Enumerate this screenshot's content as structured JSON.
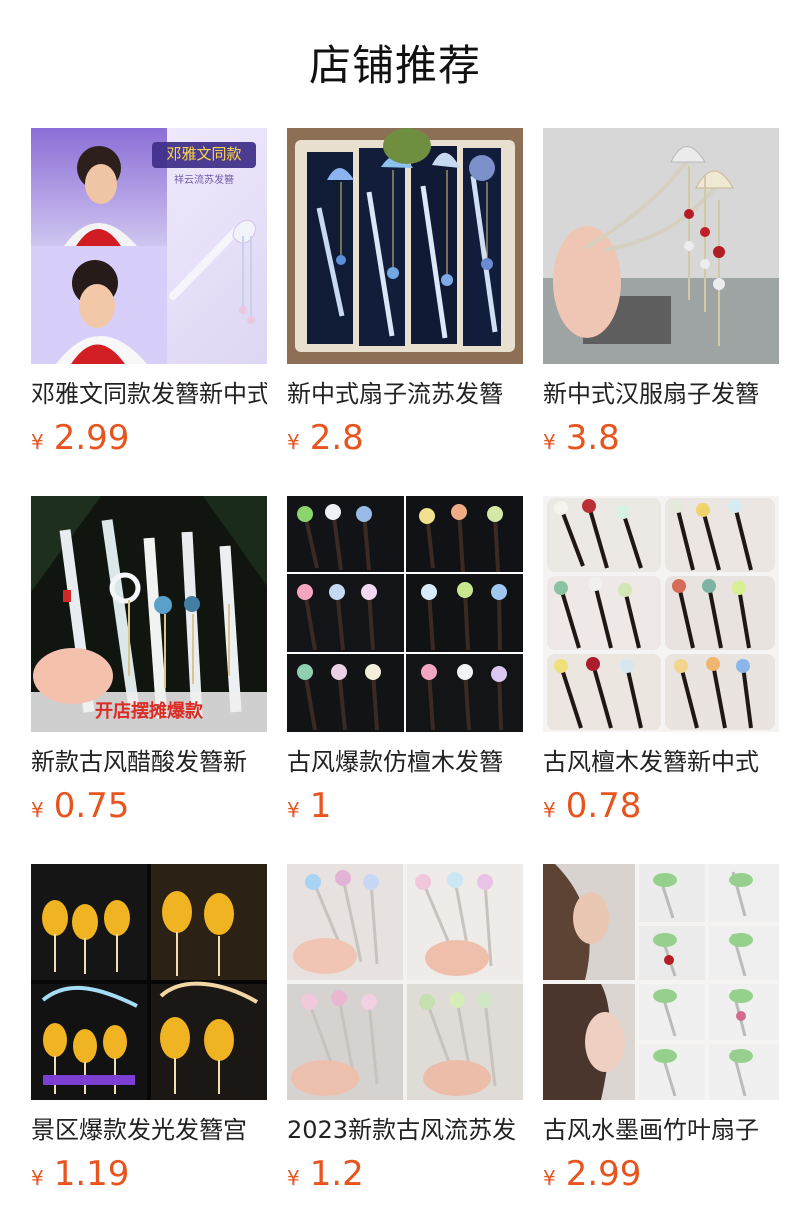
{
  "page": {
    "title": "店铺推荐"
  },
  "products": [
    {
      "name": "邓雅文同款发簪新中式",
      "currency": "¥",
      "price": "2.99",
      "image_icon": "hairpin-product-image",
      "image_text_1": "邓雅文同款",
      "image_text_2": "祥云流苏发簪"
    },
    {
      "name": "新中式扇子流苏发簪",
      "currency": "¥",
      "price": "2.8",
      "image_icon": "fan-tassel-hairpin-image"
    },
    {
      "name": "新中式汉服扇子发簪",
      "currency": "¥",
      "price": "3.8",
      "image_icon": "hanfu-fan-hairpin-image"
    },
    {
      "name": "新款古风醋酸发簪新",
      "currency": "¥",
      "price": "0.75",
      "image_icon": "acetate-hairpin-image",
      "image_text_1": "开店摆摊爆款"
    },
    {
      "name": "古风爆款仿檀木发簪",
      "currency": "¥",
      "price": "1",
      "image_icon": "wood-flower-hairpin-image"
    },
    {
      "name": "古风檀木发簪新中式",
      "currency": "¥",
      "price": "0.78",
      "image_icon": "sandalwood-hairpin-image"
    },
    {
      "name": "景区爆款发光发簪宫",
      "currency": "¥",
      "price": "1.19",
      "image_icon": "glowing-lantern-hairpin-image"
    },
    {
      "name": "2023新款古风流苏发",
      "currency": "¥",
      "price": "1.2",
      "image_icon": "tassel-flower-hairpin-image"
    },
    {
      "name": "古风水墨画竹叶扇子",
      "currency": "¥",
      "price": "2.99",
      "image_icon": "bamboo-leaf-fan-hairpin-image"
    }
  ]
}
